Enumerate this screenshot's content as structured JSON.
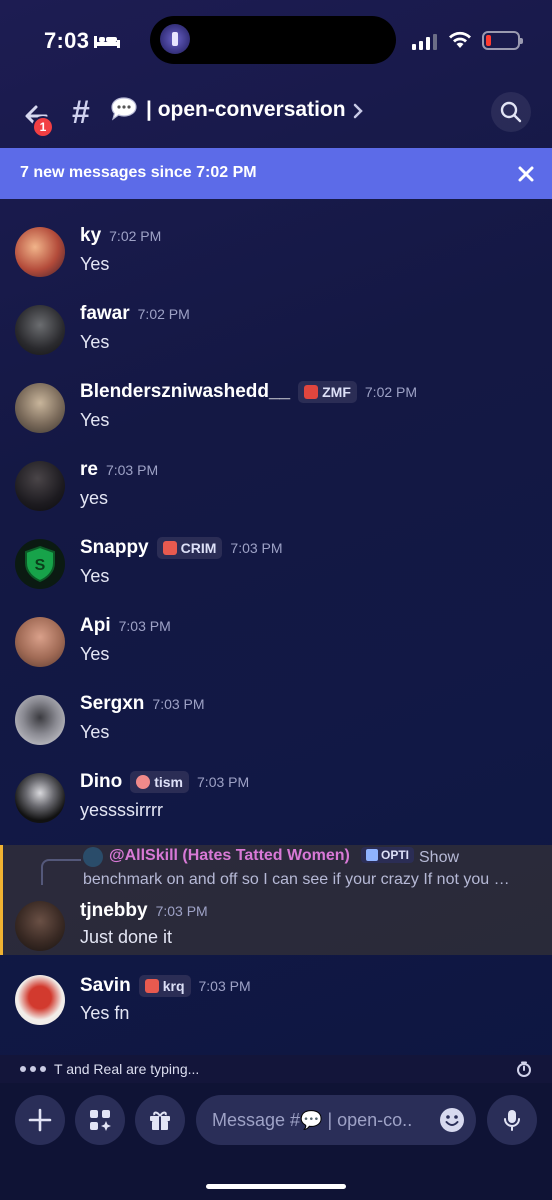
{
  "status_bar": {
    "time": "7:03"
  },
  "header": {
    "badge_count": "1",
    "hash": "#",
    "channel_name": "| open-conversation",
    "accent": "#5c6be8"
  },
  "banner": {
    "text": "7 new messages since 7:02 PM"
  },
  "messages": [
    {
      "username": "ky",
      "time": "7:02 PM",
      "text": "Yes",
      "avatar_color": "#b34b3a"
    },
    {
      "username": "fawar",
      "time": "7:02 PM",
      "text": "Yes",
      "avatar_color": "#2a2a2e"
    },
    {
      "username": "Blenderszniwashedd__",
      "tag": "ZMF",
      "time": "7:02 PM",
      "text": "Yes",
      "avatar_color": "#7a6a5a"
    },
    {
      "username": "re",
      "time": "7:03 PM",
      "text": "yes",
      "avatar_color": "#1d1b20"
    },
    {
      "username": "Snappy",
      "tag": "CRIM",
      "time": "7:03 PM",
      "text": "Yes",
      "avatar_color": "#0b3d1a"
    },
    {
      "username": "Api",
      "time": "7:03 PM",
      "text": "Yes",
      "avatar_color": "#a06a55"
    },
    {
      "username": "Sergxn",
      "time": "7:03 PM",
      "text": "Yes",
      "avatar_color": "#c9c9cf"
    },
    {
      "username": "Dino",
      "tag": "tism",
      "time": "7:03 PM",
      "text": "yessssirrrr",
      "avatar_color": "#222226"
    },
    {
      "username": "tjnebby",
      "time": "7:03 PM",
      "text": "Just done it",
      "avatar_color": "#3a2a24"
    },
    {
      "username": "Savin",
      "tag": "krq",
      "time": "7:03 PM",
      "text": "Yes fn",
      "avatar_color": "#e9e4e0"
    }
  ],
  "reply": {
    "mention": "@AllSkill (Hates Tatted Women)",
    "tag": "OPTI",
    "preview": "Show benchmark on and off so I can see if your crazy  If not you …"
  },
  "typing": {
    "text": "T and Real are typing..."
  },
  "composer": {
    "placeholder": "Message #💬 | open-co.."
  }
}
